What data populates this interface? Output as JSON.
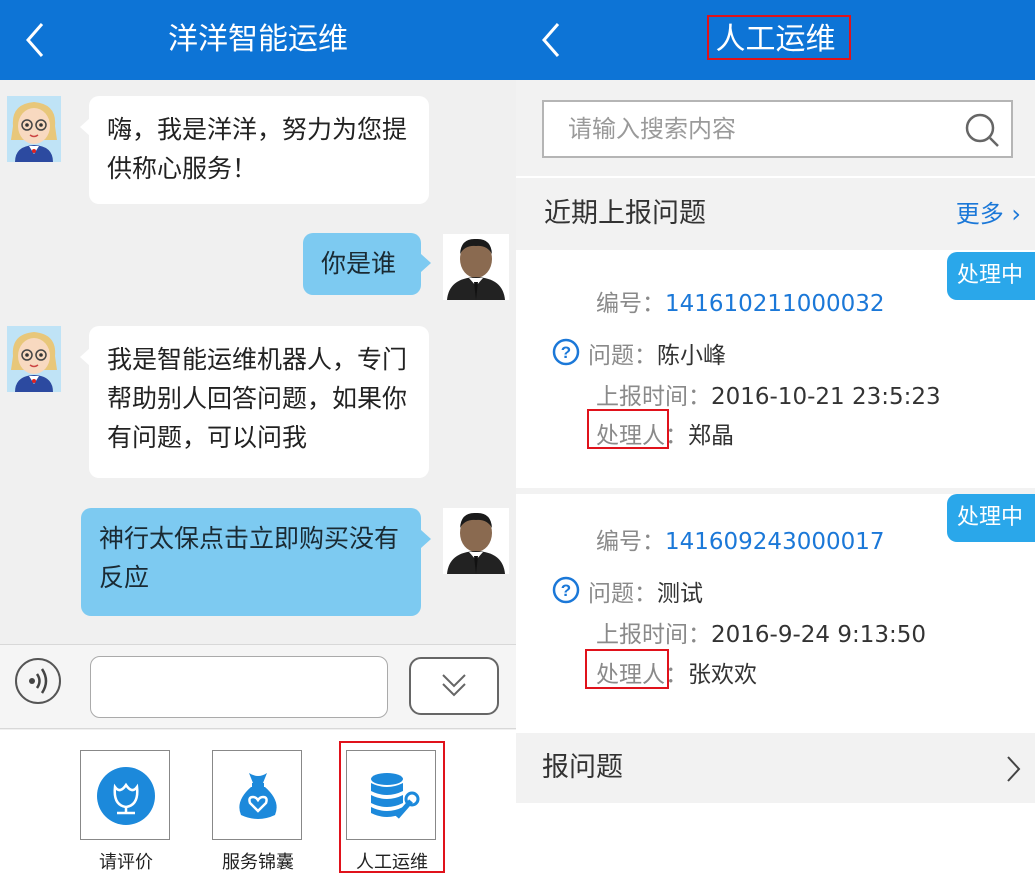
{
  "left": {
    "header": {
      "title": "洋洋智能运维"
    },
    "messages": [
      {
        "from": "bot",
        "text": "嗨，我是洋洋，努力为您提供称心服务！"
      },
      {
        "from": "user",
        "text": "你是谁"
      },
      {
        "from": "bot",
        "text": "我是智能运维机器人，专门帮助别人回答问题，如果你有问题，可以问我"
      },
      {
        "from": "user",
        "text": "神行太保点击立即购买没有反应"
      }
    ],
    "input": {
      "value": "",
      "placeholder": ""
    },
    "tools": [
      {
        "label": "请评价",
        "icon": "flower-icon"
      },
      {
        "label": "服务锦囊",
        "icon": "money-bag-icon"
      },
      {
        "label": "人工运维",
        "icon": "database-wrench-icon"
      }
    ]
  },
  "right": {
    "header": {
      "title": "人工运维"
    },
    "search": {
      "placeholder": "请输入搜索内容"
    },
    "section": {
      "title": "近期上报问题",
      "more": "更多"
    },
    "labels": {
      "number": "编号：",
      "question": "问题：",
      "time": "上报时间：",
      "handler": "处理人",
      "colon": "："
    },
    "issues": [
      {
        "number": "141610211000032",
        "question": "陈小峰",
        "time": "2016-10-21 23:5:23",
        "handler": "郑晶",
        "status": "处理中"
      },
      {
        "number": "141609243000017",
        "question": "测试",
        "time": "2016-9-24 9:13:50",
        "handler": "张欢欢",
        "status": "处理中"
      }
    ],
    "report": {
      "label": "报问题"
    }
  },
  "colors": {
    "header": "#0d74d6",
    "user_bubble": "#7dcaf1",
    "badge": "#2aa7ea",
    "link": "#1b78d8",
    "highlight": "#e0121b"
  }
}
